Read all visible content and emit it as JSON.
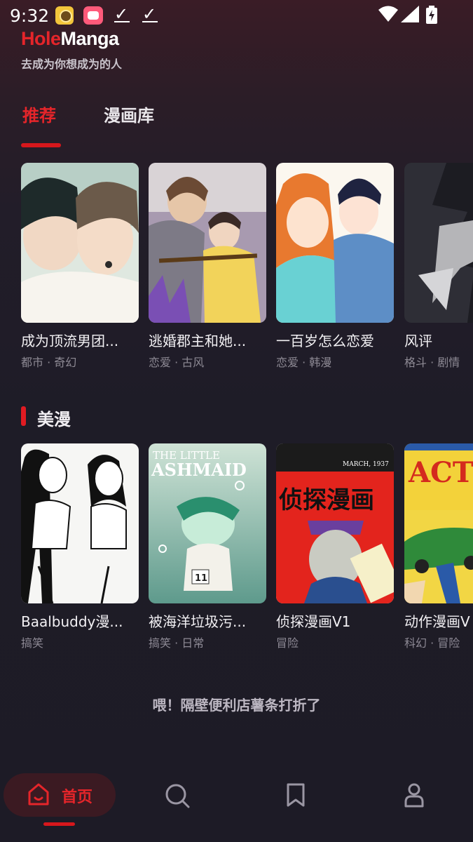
{
  "status_bar": {
    "time": "9:32",
    "icons": [
      "app-notification-icon",
      "app-notification-icon",
      "download-done-icon",
      "download-done-icon",
      "wifi-icon",
      "signal-icon",
      "battery-charging-icon"
    ]
  },
  "header": {
    "logo_part1": "Hole",
    "logo_part2": "Manga",
    "slogan": "去成为你想成为的人"
  },
  "tabs": [
    {
      "label": "推荐",
      "active": true
    },
    {
      "label": "漫画库",
      "active": false
    }
  ],
  "recommended": [
    {
      "title": "成为顶流男团...",
      "tags": "都市 · 奇幻"
    },
    {
      "title": "逃婚郡主和她...",
      "tags": "恋爱 · 古风"
    },
    {
      "title": "一百岁怎么恋爱",
      "tags": "恋爱 · 韩漫"
    },
    {
      "title": "风评",
      "tags": "格斗 · 剧情"
    }
  ],
  "american_section": {
    "title": "美漫",
    "items": [
      {
        "title": "Baalbuddy漫...",
        "tags": "搞笑"
      },
      {
        "title": "被海洋垃圾污...",
        "tags": "搞笑 · 日常"
      },
      {
        "title": "侦探漫画V1",
        "tags": "冒险",
        "cover_text": "侦探漫画",
        "cover_small": "MARCH, 1937"
      },
      {
        "title": "动作漫画V",
        "tags": "科幻 · 冒险",
        "cover_text": "ACTION COMICS"
      }
    ],
    "cover2_text": [
      "THE LITTLE",
      "ASHMAID"
    ]
  },
  "promo": "喂！隔壁便利店薯条打折了",
  "bottom_nav": {
    "home_label": "首页",
    "items": [
      "home-icon",
      "search-icon",
      "bookmark-icon",
      "profile-icon"
    ]
  },
  "colors": {
    "accent": "#e5252a",
    "background": "#1e1b26"
  }
}
